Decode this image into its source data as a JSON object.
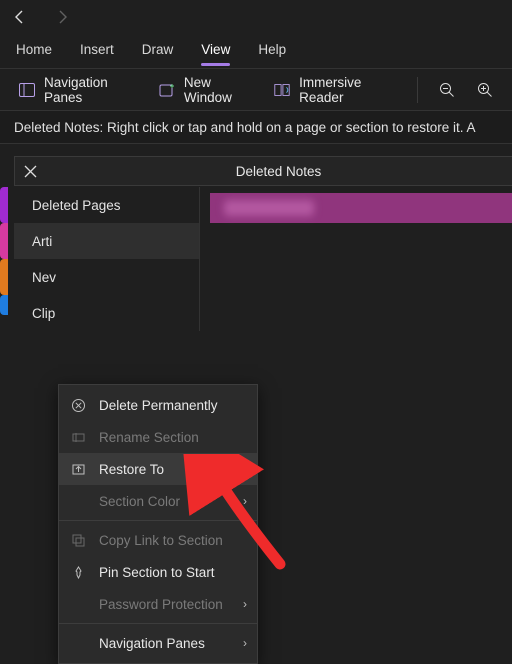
{
  "tabs": {
    "home": "Home",
    "insert": "Insert",
    "draw": "Draw",
    "view": "View",
    "help": "Help"
  },
  "ribbon": {
    "nav_panes": "Navigation Panes",
    "new_window": "New Window",
    "immersive_reader": "Immersive Reader"
  },
  "infobar": "Deleted Notes: Right click or tap and hold on a page or section to restore it. A",
  "header_title": "Deleted Notes",
  "sidebar": {
    "heading": "Deleted Pages",
    "items": [
      "Arti",
      "Nev",
      "Clip"
    ]
  },
  "context_menu": {
    "delete_permanently": "Delete Permanently",
    "rename_section": "Rename Section",
    "restore_to": "Restore To",
    "section_color": "Section Color",
    "copy_link": "Copy Link to Section",
    "pin": "Pin Section to Start",
    "password": "Password Protection",
    "nav_panes": "Navigation Panes"
  }
}
